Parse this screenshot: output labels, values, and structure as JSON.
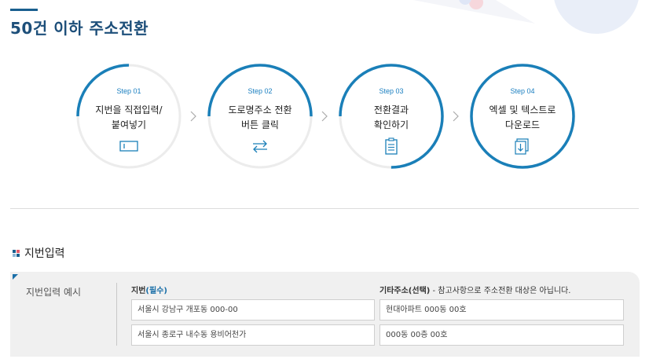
{
  "page": {
    "title": "50건 이하 주소전환"
  },
  "steps": [
    {
      "label": "Step 01",
      "lines": [
        "지번을 직접입력/",
        "붙여넣기"
      ],
      "icon": "input-box-icon",
      "progress": 0.25
    },
    {
      "label": "Step 02",
      "lines": [
        "도로명주소 전환",
        "버튼 클릭"
      ],
      "icon": "convert-arrows-icon",
      "progress": 0.5
    },
    {
      "label": "Step 03",
      "lines": [
        "전환결과",
        "확인하기"
      ],
      "icon": "clipboard-icon",
      "progress": 0.75
    },
    {
      "label": "Step 04",
      "lines": [
        "엑셀 및 텍스트로",
        "다운로드"
      ],
      "icon": "download-doc-icon",
      "progress": 1.0
    }
  ],
  "section": {
    "title": "지번입력",
    "icon": "section-squares-icon"
  },
  "example": {
    "label": "지번입력 예시",
    "col1": {
      "head": "지번",
      "required": "(필수)"
    },
    "col2": {
      "head": "기타주소(선택)",
      "note": " - 참고사항으로 주소전환 대상은 아닙니다."
    },
    "rows": [
      {
        "jibun": "서울시 강남구 개포동 000-00",
        "etc": "현대아파트 000동 00호"
      },
      {
        "jibun": "서울시 종로구 내수동 용비어천가",
        "etc": "000동 00층 00호"
      }
    ]
  },
  "colors": {
    "accent": "#1a7fb8",
    "title": "#1d4f7a",
    "ring_track": "#ececec"
  }
}
